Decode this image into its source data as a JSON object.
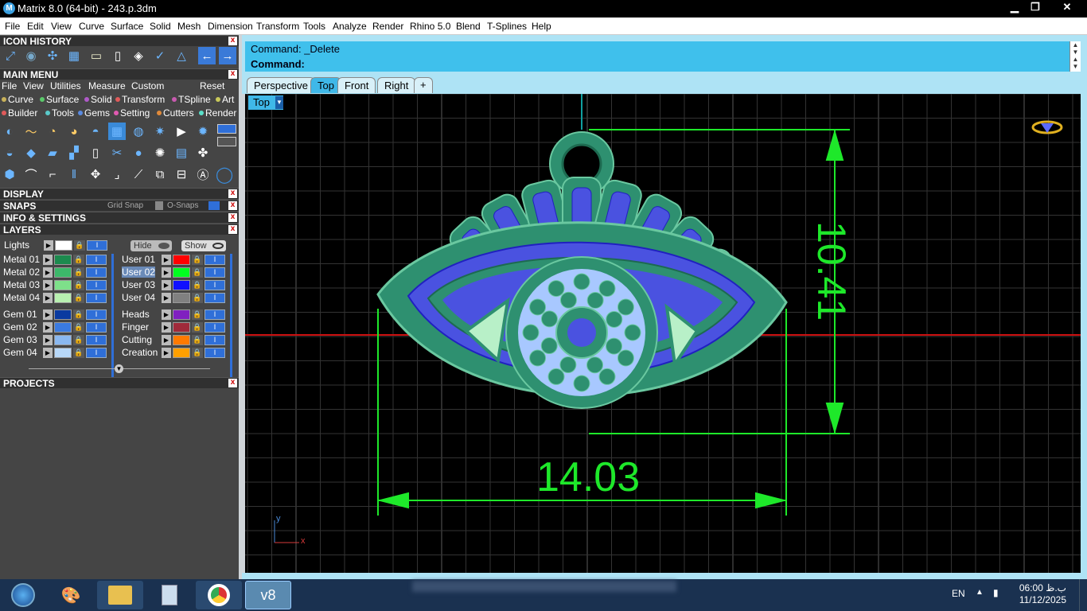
{
  "window": {
    "title": "Matrix 8.0 (64-bit) - 243.p.3dm",
    "icon": "v8",
    "minimize": "▁",
    "maximize": "❐",
    "close": "✕"
  },
  "menubar": [
    "File",
    "Edit",
    "View",
    "Curve",
    "Surface",
    "Solid",
    "Mesh",
    "Dimension",
    "Transform",
    "Tools",
    "Analyze",
    "Render",
    "Rhino 5.0",
    "Blend",
    "T-Splines",
    "Help"
  ],
  "icon_history": {
    "title": "ICON HISTORY"
  },
  "main_menu": {
    "title": "MAIN MENU",
    "top": [
      "File",
      "View",
      "Utilities",
      "Measure",
      "Custom"
    ],
    "reset": "Reset",
    "row1": [
      {
        "label": "Curve",
        "color": "#c9b25a"
      },
      {
        "label": "Surface",
        "color": "#5ac96a"
      },
      {
        "label": "Solid",
        "color": "#b05ac9"
      },
      {
        "label": "Transform",
        "color": "#e05a5a"
      },
      {
        "label": "TSpline",
        "color": "#c95ab0"
      },
      {
        "label": "Art",
        "color": "#c9c95a"
      }
    ],
    "row2": [
      {
        "label": "Builder",
        "color": "#e05a5a"
      },
      {
        "label": "Tools",
        "color": "#5ac9c9"
      },
      {
        "label": "Gems",
        "color": "#5a8ae0"
      },
      {
        "label": "Setting",
        "color": "#e05ab0"
      },
      {
        "label": "Cutters",
        "color": "#e08a3a"
      },
      {
        "label": "Render",
        "color": "#5ae0c9"
      }
    ]
  },
  "display": {
    "title": "DISPLAY"
  },
  "snaps": {
    "title": "SNAPS",
    "grid_snap": "Grid Snap",
    "osnaps": "O-Snaps"
  },
  "info": {
    "title": "INFO & SETTINGS"
  },
  "layers": {
    "title": "LAYERS",
    "lights": "Lights",
    "hide": "Hide",
    "show": "Show",
    "left": [
      {
        "name": "Metal 01",
        "color": "#1c8a4e"
      },
      {
        "name": "Metal 02",
        "color": "#3cb86a"
      },
      {
        "name": "Metal 03",
        "color": "#7ee08a"
      },
      {
        "name": "Metal 04",
        "color": "#b8f0b0"
      },
      {
        "name": "Gem 01",
        "color": "#0a3aa0"
      },
      {
        "name": "Gem 02",
        "color": "#3a7ae0"
      },
      {
        "name": "Gem 03",
        "color": "#8ab8f0"
      },
      {
        "name": "Gem 04",
        "color": "#b8d8f8"
      }
    ],
    "right": [
      {
        "name": "User 01",
        "color": "#ff0000"
      },
      {
        "name": "User 02",
        "color": "#00ff20"
      },
      {
        "name": "User 03",
        "color": "#1010ff"
      },
      {
        "name": "User 04",
        "color": "#808080"
      },
      {
        "name": "Heads",
        "color": "#8020c0"
      },
      {
        "name": "Finger",
        "color": "#a02a3a"
      },
      {
        "name": "Cutting",
        "color": "#ff7a00"
      },
      {
        "name": "Creation",
        "color": "#ffa000"
      }
    ]
  },
  "projects": {
    "title": "PROJECTS"
  },
  "command": {
    "line1": "Command: _Delete",
    "line2": "Command:"
  },
  "tabs": [
    {
      "label": "Perspective",
      "active": false
    },
    {
      "label": "Top",
      "active": true
    },
    {
      "label": "Front",
      "active": false
    },
    {
      "label": "Right",
      "active": false
    }
  ],
  "tab_add": "+",
  "viewport": {
    "label": "Top",
    "dim_width": "14.03",
    "dim_height": "10.41",
    "axis_x": "x",
    "axis_y": "y"
  },
  "taskbar": {
    "lang": "EN",
    "time": "06:00 ب.ظ",
    "date": "11/12/2025",
    "active_app": "v8"
  }
}
